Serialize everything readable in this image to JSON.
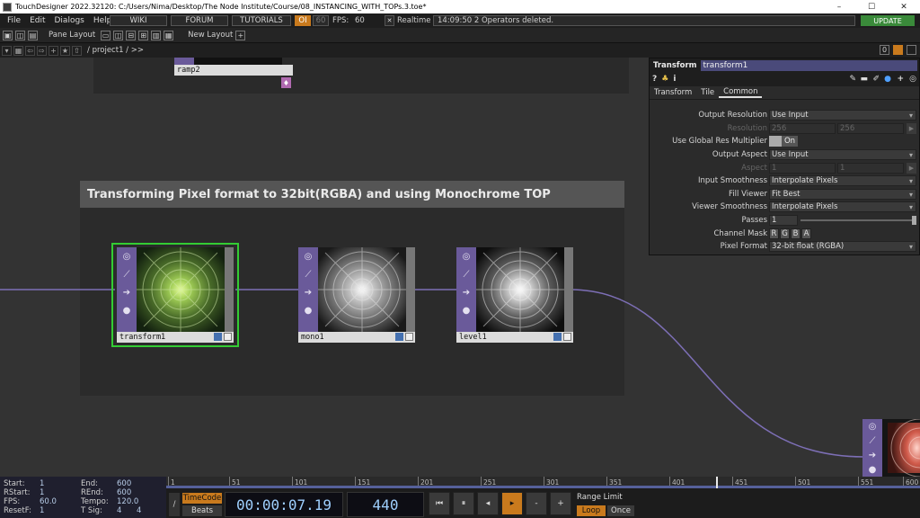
{
  "title_bar": {
    "title": "TouchDesigner 2022.32120: C:/Users/Nima/Desktop/The Node Institute/Course/08_INSTANCING_WITH_TOPs.3.toe*",
    "minimize": "–",
    "maximize": "☐",
    "close": "✕"
  },
  "menu": {
    "items": [
      "File",
      "Edit",
      "Dialogs",
      "Help"
    ],
    "wiki": "WIKI",
    "forum": "FORUM",
    "tutorials": "TUTORIALS",
    "oi": "OI",
    "fps_value_box": "60",
    "fps_label": "FPS:",
    "fps_value": "60",
    "realtime_check": "✕",
    "realtime": "Realtime",
    "status": "14:09:50 2 Operators deleted.",
    "update": "UPDATE"
  },
  "pane_bar": {
    "pane_layout": "Pane Layout",
    "new_layout": "New Layout",
    "add": "+"
  },
  "path_bar": {
    "path": "/ project1 / >>",
    "zero": "0"
  },
  "network": {
    "ramp_label": "ramp2",
    "annotation_title": "Transforming Pixel format to 32bit(RGBA) and using Monochrome TOP",
    "nodes": [
      {
        "name": "transform1"
      },
      {
        "name": "mono1"
      },
      {
        "name": "level1"
      }
    ]
  },
  "params": {
    "op_type": "Transform",
    "op_name": "transform1",
    "tabs": [
      "Transform",
      "Tile",
      "Common"
    ],
    "rows": [
      {
        "label": "Output Resolution",
        "value": "Use Input"
      },
      {
        "label": "Resolution",
        "value": "256",
        "value2": "256"
      },
      {
        "label": "Use Global Res Multiplier",
        "value": "On"
      },
      {
        "label": "Output Aspect",
        "value": "Use Input"
      },
      {
        "label": "Aspect",
        "value": "1",
        "value2": "1"
      },
      {
        "label": "Input Smoothness",
        "value": "Interpolate Pixels"
      },
      {
        "label": "Fill Viewer",
        "value": "Fit Best"
      },
      {
        "label": "Viewer Smoothness",
        "value": "Interpolate Pixels"
      },
      {
        "label": "Passes",
        "value": "1"
      },
      {
        "label": "Channel Mask",
        "value": "R",
        "value2": "G",
        "value3": "B",
        "value4": "A"
      },
      {
        "label": "Pixel Format",
        "value": "32-bit float (RGBA)"
      }
    ]
  },
  "timeline": {
    "stats": {
      "start_label": "Start:",
      "start": "1",
      "rstart_label": "RStart:",
      "rstart": "1",
      "fps_label": "FPS:",
      "fps": "60.0",
      "resetf_label": "ResetF:",
      "resetf": "1",
      "end_label": "End:",
      "end": "600",
      "rend_label": "REnd:",
      "rend": "600",
      "tempo_label": "Tempo:",
      "tempo": "120.0",
      "tsig_label": "T Sig:",
      "tsig1": "4",
      "tsig2": "4"
    },
    "ruler_ticks": [
      "1",
      "51",
      "101",
      "151",
      "201",
      "251",
      "301",
      "351",
      "401",
      "451",
      "501",
      "551",
      "600"
    ],
    "timecode_btn": "TimeCode",
    "beats_btn": "Beats",
    "timecode": "00:00:07.19",
    "frame": "440",
    "controls": [
      "⏮",
      "⏸",
      "◂",
      "▸",
      "-",
      "+"
    ],
    "range_limit": "Range Limit",
    "loop": "Loop",
    "once": "Once"
  }
}
